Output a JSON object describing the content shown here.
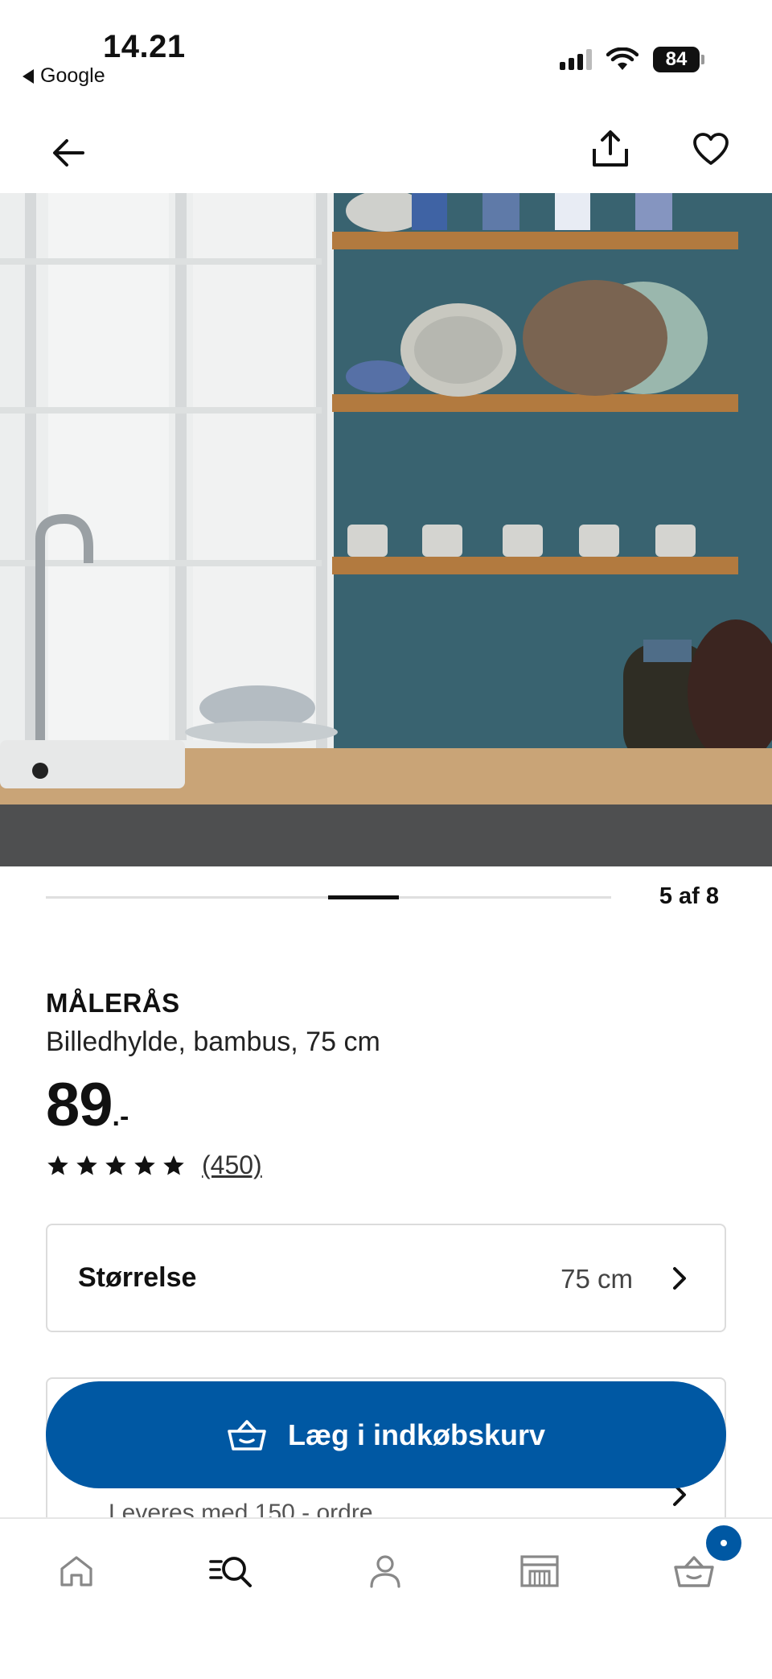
{
  "status_bar": {
    "time": "14.21",
    "back_app": "Google",
    "battery": "84"
  },
  "header": {
    "back_icon": "arrow-left-icon",
    "share_icon": "share-icon",
    "favorite_icon": "heart-icon"
  },
  "gallery": {
    "counter": "5 af 8",
    "current_index": 5,
    "total": 8
  },
  "product": {
    "name": "MÅLERÅS",
    "description": "Billedhylde, bambus, 75 cm",
    "price": "89",
    "price_suffix": ".-",
    "rating_stars": 5,
    "review_count": "(450)"
  },
  "size_selector": {
    "label": "Størrelse",
    "value": "75 cm"
  },
  "delivery": {
    "text": "Leveres med 150,- ordre"
  },
  "cart_button": {
    "label": "Læg i indkøbskurv",
    "icon": "basket-icon"
  },
  "bottom_nav": {
    "items": [
      "home-icon",
      "search-icon",
      "profile-icon",
      "store-icon",
      "basket-icon"
    ]
  },
  "colors": {
    "accent": "#0058a3",
    "text": "#111111",
    "border": "#dcdcdc"
  }
}
